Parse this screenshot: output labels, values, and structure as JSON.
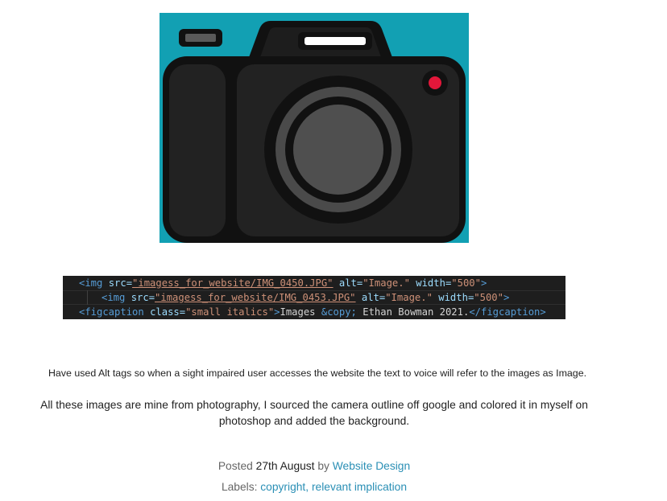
{
  "image": {
    "icon": "camera-icon",
    "background_color": "#12a0b3"
  },
  "code": {
    "line1": {
      "tag_open": "<img ",
      "attr_src": "src=",
      "src_val": "\"imagess_for_website/IMG_0450.JPG\"",
      "attr_alt": " alt=",
      "alt_val": "\"Image.\"",
      "attr_width": " width=",
      "width_val": "\"500\"",
      "tag_close": ">"
    },
    "line2": {
      "tag_open": "<img ",
      "attr_src": "src=",
      "src_val": "\"imagess_for_website/IMG_0453.JPG\"",
      "attr_alt": " alt=",
      "alt_val": "\"Image.\"",
      "attr_width": " width=",
      "width_val": "\"500\"",
      "tag_close": ">"
    },
    "line3": {
      "tag_open": "<figcaption ",
      "attr_class": "class=",
      "class_val": "\"small italics\"",
      "gt": ">",
      "text1": "Images ",
      "entity": "&copy;",
      "text2": " Ethan Bowman 2021.",
      "tag_close": "</figcaption>"
    }
  },
  "post": {
    "para1": "Have used Alt tags so when a sight impaired user accesses the website the text to voice will refer to the images as Image.",
    "para2": "All these images are mine from photography, I sourced the camera outline off google and colored it in myself on photoshop and added the background.",
    "posted_prefix": "Posted ",
    "posted_date": "27th August",
    "posted_by": " by ",
    "author": "Website Design",
    "labels_prefix": "Labels: ",
    "label1": "copyright",
    "label_sep": ", ",
    "label2": "relevant implication"
  }
}
